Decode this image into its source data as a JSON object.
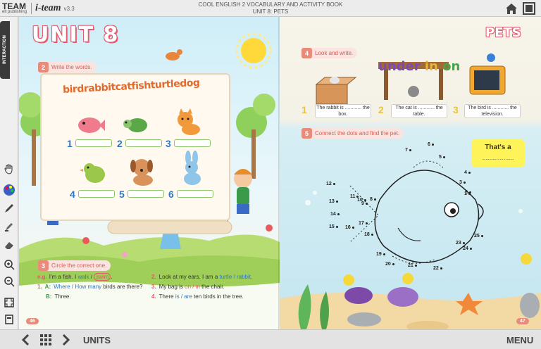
{
  "app": {
    "brand": "TEAM",
    "brand_sub": "elt publishing",
    "product": "i-team",
    "version": "v3.3",
    "book_title": "COOL ENGLISH 2 VOCABULARY AND ACTIVITY BOOK",
    "unit_title": "UNIT 8: PETS"
  },
  "left_toolbar": {
    "tab_label": "INTERACTION",
    "tools": [
      "hand-icon",
      "palette-icon",
      "pen-icon",
      "highlighter-icon",
      "eraser-icon",
      "zoom-in-icon",
      "zoom-out-icon",
      "fit-icon",
      "fullpage-icon"
    ]
  },
  "bottom_bar": {
    "units_label": "UNITS",
    "menu_label": "MENU"
  },
  "left_page": {
    "unit_heading": "UNIT 8",
    "ex2": {
      "num": "2",
      "label": "Write the words."
    },
    "banner": "birdrabbitcatfishturtledog",
    "word_nums": [
      "1",
      "2",
      "3",
      "4",
      "5",
      "6"
    ],
    "ex3": {
      "num": "3",
      "label": "Circle the correct one.",
      "eg_label": "e.g.",
      "eg_text_pre": "I'm a fish. I",
      "eg_option1": "walk",
      "eg_option2": "swim",
      "eg_end": ".",
      "q1_num": "1.",
      "q1_a": "A:",
      "q1_opts": "Where / How many",
      "q1_text": "birds are there?",
      "q1_b": "B:",
      "q1_b_text": "Three.",
      "q2_num": "2.",
      "q2_text": "Look at my ears. I am a",
      "q2_opts": "turtle / rabbit.",
      "q3_num": "3.",
      "q3_text_pre": "My bag is",
      "q3_opts": "on / in",
      "q3_text_post": "the chair.",
      "q4_num": "4.",
      "q4_text_pre": "There",
      "q4_opts": "is / are",
      "q4_text_post": "ten birds in the tree."
    },
    "page_number": "46"
  },
  "right_page": {
    "heading": "PETS",
    "ex4": {
      "num": "4",
      "label": "Look and write."
    },
    "uio": {
      "under": "under",
      "in": "in",
      "on": "on"
    },
    "captions": [
      {
        "num": "1",
        "text": "The rabbit is ............ the box."
      },
      {
        "num": "2",
        "text": "The cat is ............ the table."
      },
      {
        "num": "3",
        "text": "The bird is ............ the television."
      }
    ],
    "ex5": {
      "num": "5",
      "label": "Connect the dots and find the pet."
    },
    "thatsa": {
      "title": "That's a",
      "dots": "..........................."
    },
    "dot_numbers": [
      "1",
      "2",
      "3",
      "4",
      "5",
      "6",
      "7",
      "8",
      "9",
      "10",
      "11",
      "12",
      "13",
      "14",
      "15",
      "16",
      "17",
      "18",
      "19",
      "20",
      "21",
      "22",
      "23",
      "24",
      "25"
    ],
    "page_number": "47"
  },
  "colors": {
    "accent_pink": "#e35b6d",
    "accent_blue": "#2f78c4",
    "accent_green": "#3aa149",
    "accent_yellow": "#e9c33a"
  }
}
